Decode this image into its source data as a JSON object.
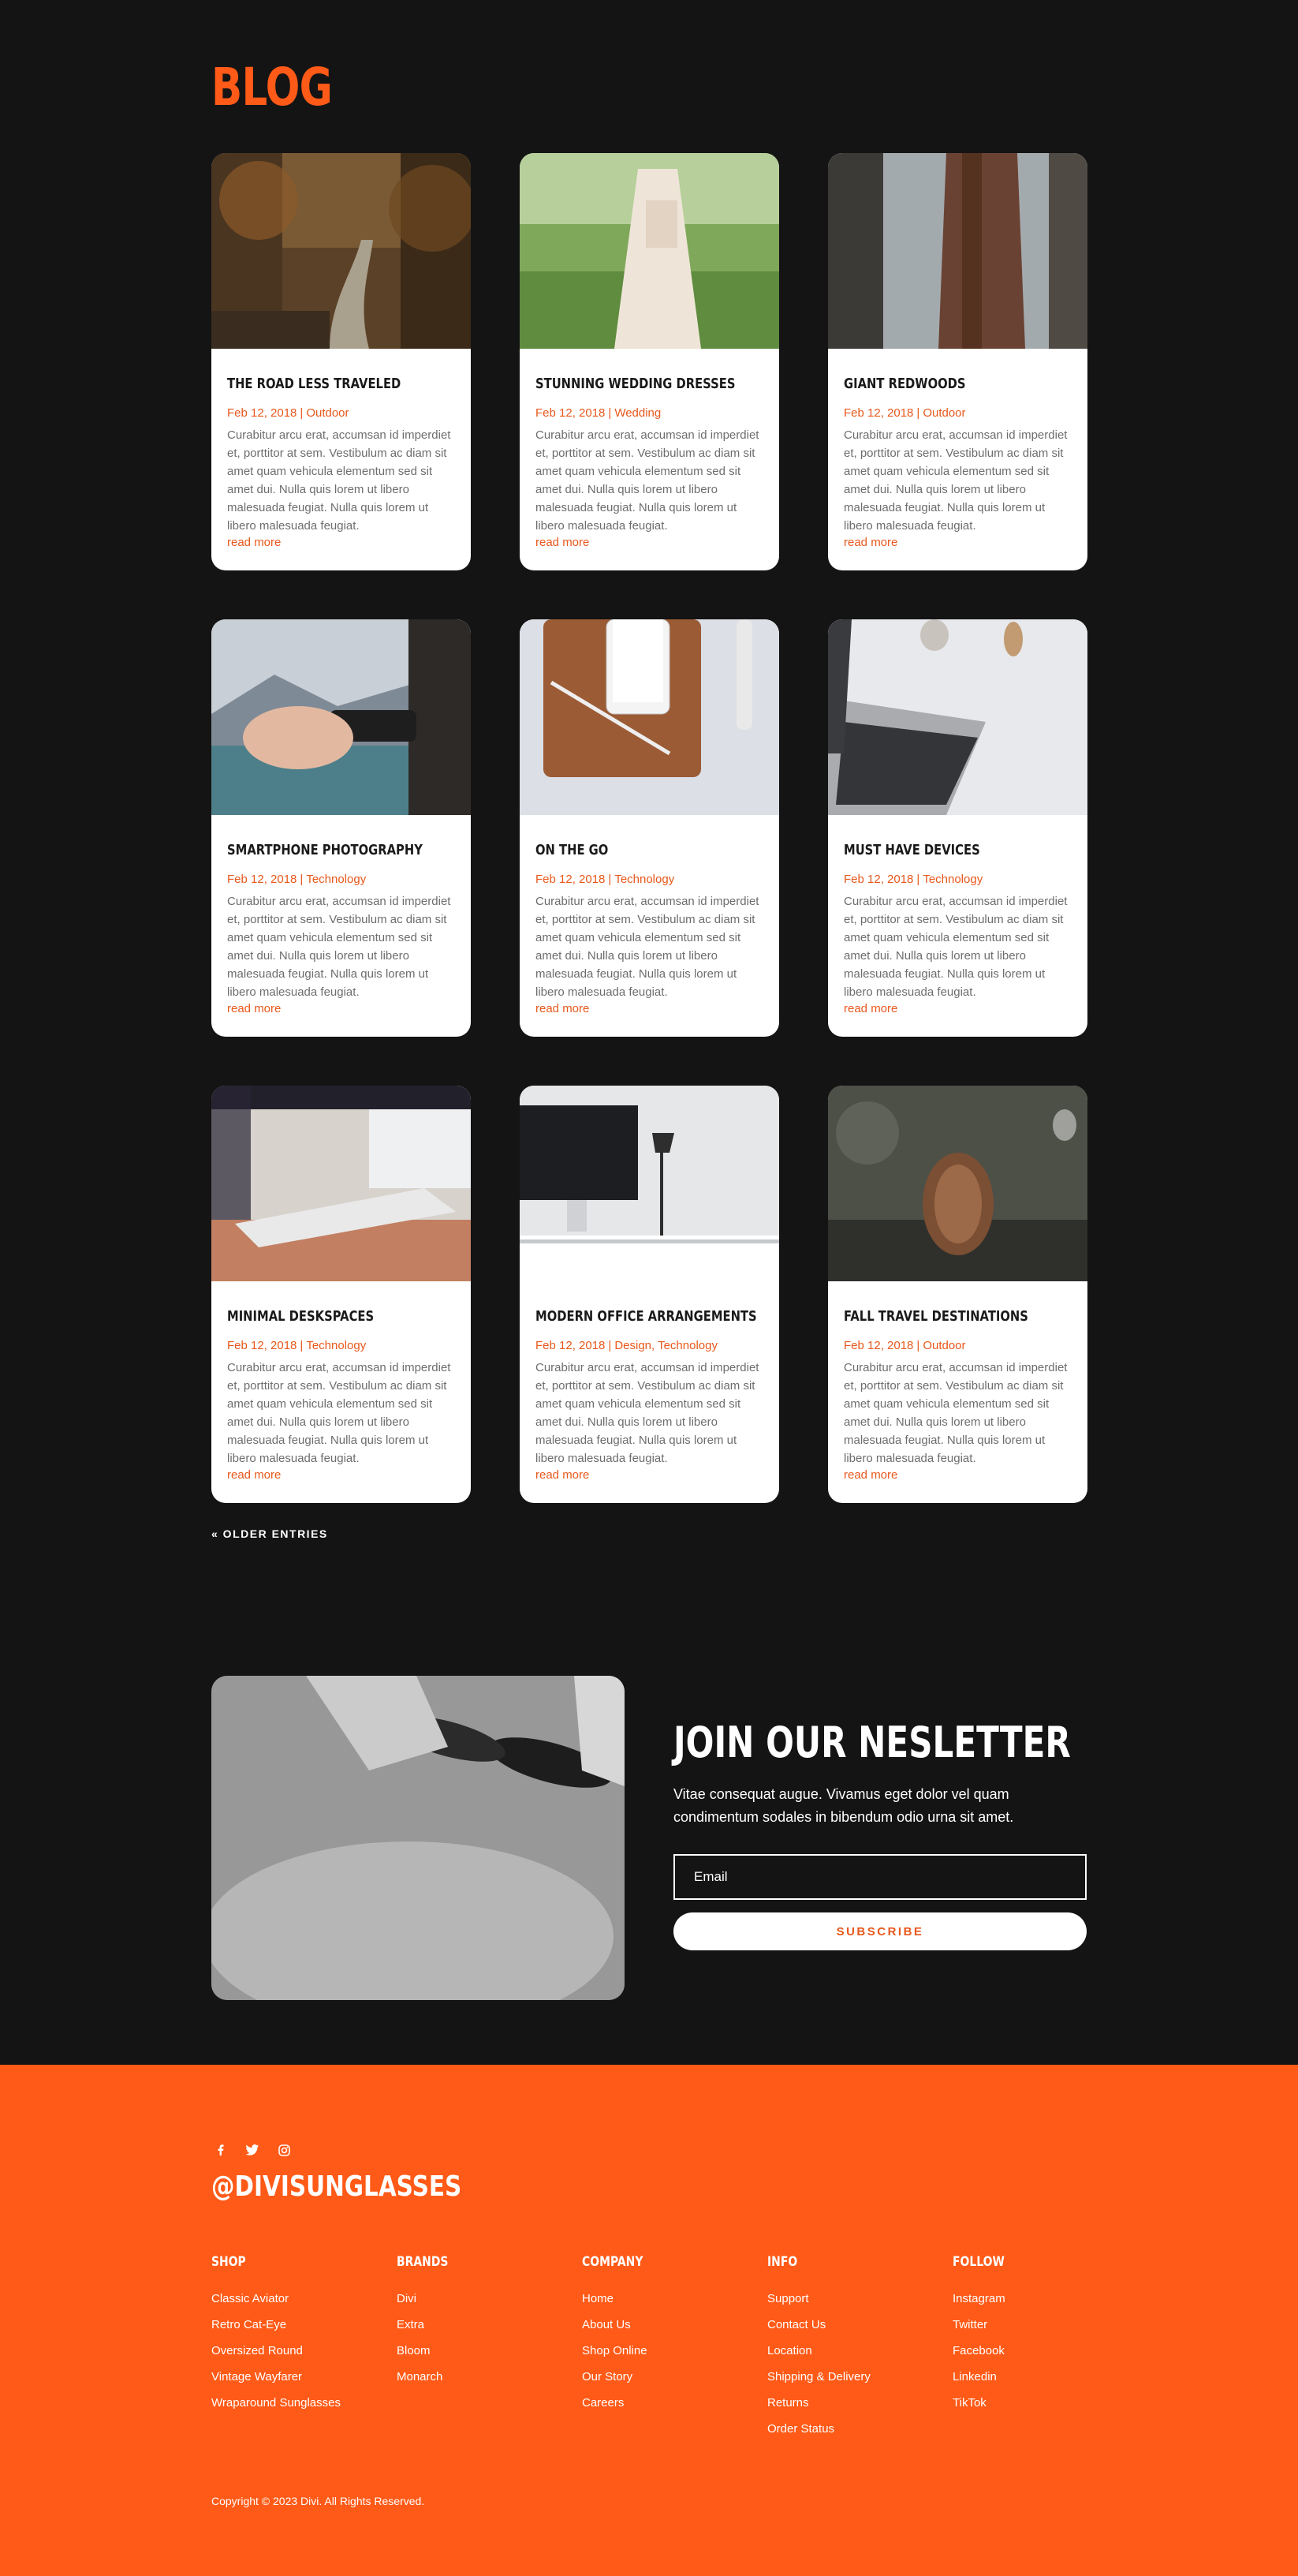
{
  "blog": {
    "title": "BLOG",
    "posts": [
      {
        "title": "The Road Less Traveled",
        "date": "Feb 12, 2018",
        "category": "Outdoor",
        "excerpt": "Curabitur arcu erat, accumsan id imperdiet et, porttitor at sem. Vestibulum ac diam sit amet quam vehicula elementum sed sit amet dui. Nulla quis lorem ut libero malesuada feugiat. Nulla quis lorem ut libero malesuada feugiat.",
        "more": "read more"
      },
      {
        "title": "Stunning Wedding Dresses",
        "date": "Feb 12, 2018",
        "category": "Wedding",
        "excerpt": "Curabitur arcu erat, accumsan id imperdiet et, porttitor at sem. Vestibulum ac diam sit amet quam vehicula elementum sed sit amet dui. Nulla quis lorem ut libero malesuada feugiat. Nulla quis lorem ut libero malesuada feugiat.",
        "more": "read more"
      },
      {
        "title": "Giant Redwoods",
        "date": "Feb 12, 2018",
        "category": "Outdoor",
        "excerpt": "Curabitur arcu erat, accumsan id imperdiet et, porttitor at sem. Vestibulum ac diam sit amet quam vehicula elementum sed sit amet dui. Nulla quis lorem ut libero malesuada feugiat. Nulla quis lorem ut libero malesuada feugiat.",
        "more": "read more"
      },
      {
        "title": "Smartphone Photography",
        "date": "Feb 12, 2018",
        "category": "Technology",
        "excerpt": "Curabitur arcu erat, accumsan id imperdiet et, porttitor at sem. Vestibulum ac diam sit amet quam vehicula elementum sed sit amet dui. Nulla quis lorem ut libero malesuada feugiat. Nulla quis lorem ut libero malesuada feugiat.",
        "more": "read more"
      },
      {
        "title": "On The Go",
        "date": "Feb 12, 2018",
        "category": "Technology",
        "excerpt": "Curabitur arcu erat, accumsan id imperdiet et, porttitor at sem. Vestibulum ac diam sit amet quam vehicula elementum sed sit amet dui. Nulla quis lorem ut libero malesuada feugiat. Nulla quis lorem ut libero malesuada feugiat.",
        "more": "read more"
      },
      {
        "title": "Must Have Devices",
        "date": "Feb 12, 2018",
        "category": "Technology",
        "excerpt": "Curabitur arcu erat, accumsan id imperdiet et, porttitor at sem. Vestibulum ac diam sit amet quam vehicula elementum sed sit amet dui. Nulla quis lorem ut libero malesuada feugiat. Nulla quis lorem ut libero malesuada feugiat.",
        "more": "read more"
      },
      {
        "title": "Minimal Deskspaces",
        "date": "Feb 12, 2018",
        "category": "Technology",
        "excerpt": "Curabitur arcu erat, accumsan id imperdiet et, porttitor at sem. Vestibulum ac diam sit amet quam vehicula elementum sed sit amet dui. Nulla quis lorem ut libero malesuada feugiat. Nulla quis lorem ut libero malesuada feugiat.",
        "more": "read more"
      },
      {
        "title": "Modern Office Arrangements",
        "date": "Feb 12, 2018",
        "category": "Design, Technology",
        "excerpt": "Curabitur arcu erat, accumsan id imperdiet et, porttitor at sem. Vestibulum ac diam sit amet quam vehicula elementum sed sit amet dui. Nulla quis lorem ut libero malesuada feugiat. Nulla quis lorem ut libero malesuada feugiat.",
        "more": "read more"
      },
      {
        "title": "Fall Travel Destinations",
        "date": "Feb 12, 2018",
        "category": "Outdoor",
        "excerpt": "Curabitur arcu erat, accumsan id imperdiet et, porttitor at sem. Vestibulum ac diam sit amet quam vehicula elementum sed sit amet dui. Nulla quis lorem ut libero malesuada feugiat. Nulla quis lorem ut libero malesuada feugiat.",
        "more": "read more"
      }
    ],
    "older_entries": "« OLDER ENTRIES"
  },
  "newsletter": {
    "title": "JOIN OUR NESLETTER",
    "text": "Vitae consequat augue. Vivamus eget dolor vel quam condimentum sodales in bibendum odio urna sit amet.",
    "email_placeholder": "Email",
    "subscribe_label": "SUBSCRIBE"
  },
  "footer": {
    "social_icons": [
      "facebook-icon",
      "twitter-icon",
      "instagram-icon"
    ],
    "handle": "@DIVISUNGLASSES",
    "columns": [
      {
        "heading": "Shop",
        "links": [
          "Classic Aviator",
          "Retro Cat-Eye",
          "Oversized Round",
          "Vintage Wayfarer",
          "Wraparound Sunglasses"
        ]
      },
      {
        "heading": "Brands",
        "links": [
          "Divi",
          "Extra",
          "Bloom",
          "Monarch"
        ]
      },
      {
        "heading": "Company",
        "links": [
          "Home",
          "About Us",
          "Shop Online",
          "Our Story",
          "Careers"
        ]
      },
      {
        "heading": "Info",
        "links": [
          "Support",
          "Contact Us",
          "Location",
          "Shipping & Delivery",
          "Returns",
          "Order Status"
        ]
      },
      {
        "heading": "Follow",
        "links": [
          "Instagram",
          "Twitter",
          "Facebook",
          "Linkedin",
          "TikTok"
        ]
      }
    ],
    "copyright": "Copyright © 2023 Divi. All Rights Reserved."
  },
  "colors": {
    "accent": "#ff5a17",
    "background": "#141414",
    "meta": "#e8581c"
  }
}
